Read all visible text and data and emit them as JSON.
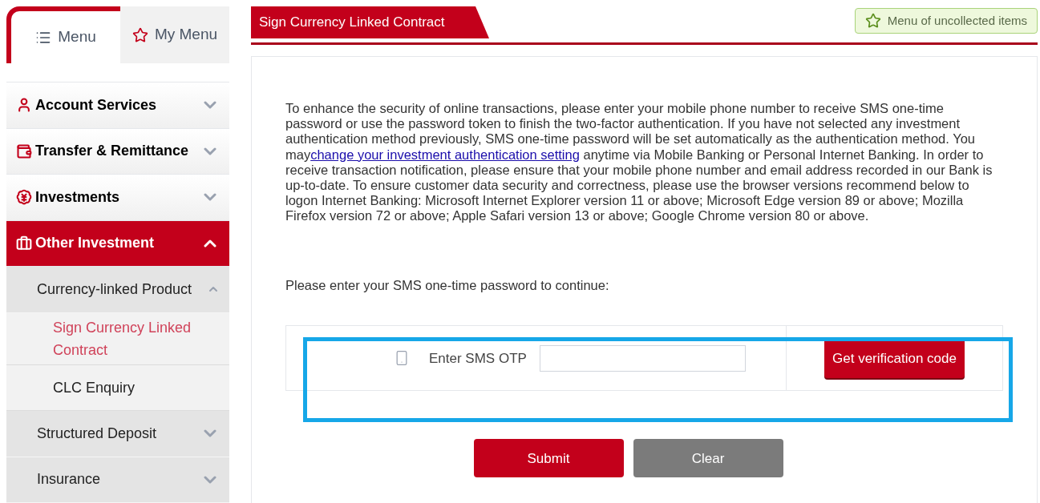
{
  "sidebar": {
    "tabs": [
      {
        "label": "Menu",
        "selected": true
      },
      {
        "label": "My Menu",
        "selected": false
      }
    ],
    "items": [
      {
        "label": "Account Services",
        "expanded": false,
        "selected": false
      },
      {
        "label": "Transfer & Remittance",
        "expanded": false,
        "selected": false
      },
      {
        "label": "Investments",
        "expanded": false,
        "selected": false
      },
      {
        "label": "Other Investment",
        "expanded": true,
        "selected": true,
        "children": [
          {
            "label": "Currency-linked Product",
            "expanded": true,
            "children": [
              {
                "label": "Sign Currency Linked Contract",
                "selected": true
              },
              {
                "label": "CLC Enquiry",
                "selected": false
              }
            ]
          },
          {
            "label": "Structured Deposit",
            "expanded": false
          },
          {
            "label": "Insurance",
            "expanded": false
          }
        ]
      }
    ]
  },
  "page": {
    "title": "Sign Currency Linked Contract",
    "collect_button": "Menu of uncollected items",
    "notice": {
      "before": "To enhance the security of online transactions, please enter your mobile phone number to receive SMS one-time password or use the password token to finish the two-factor authentication. If you have not selected any investment authentication method previously, SMS one-time password will be set automatically as the authentication method. You may",
      "link": "change your investment authentication setting",
      "after": " anytime via Mobile Banking or Personal Internet Banking. In order to receive transaction notification, please ensure that your mobile phone number and email address recorded in our Bank is up-to-date. To ensure customer data security and correctness, please use the browser versions recommend below to logon Internet Banking: Microsoft Internet Explorer version 11 or above; Microsoft Edge version 89 or above; Mozilla Firefox version 72 or above; Apple Safari version 13 or above; Google Chrome version 80 or above."
    },
    "prompt": "Please enter your SMS one-time password to continue:",
    "otp": {
      "label": "Enter SMS OTP",
      "get_code_button": "Get verification code"
    },
    "highlighted": true,
    "buttons": [
      {
        "label": "Submit",
        "kind": "primary"
      },
      {
        "label": "Clear",
        "kind": "secondary"
      }
    ]
  }
}
